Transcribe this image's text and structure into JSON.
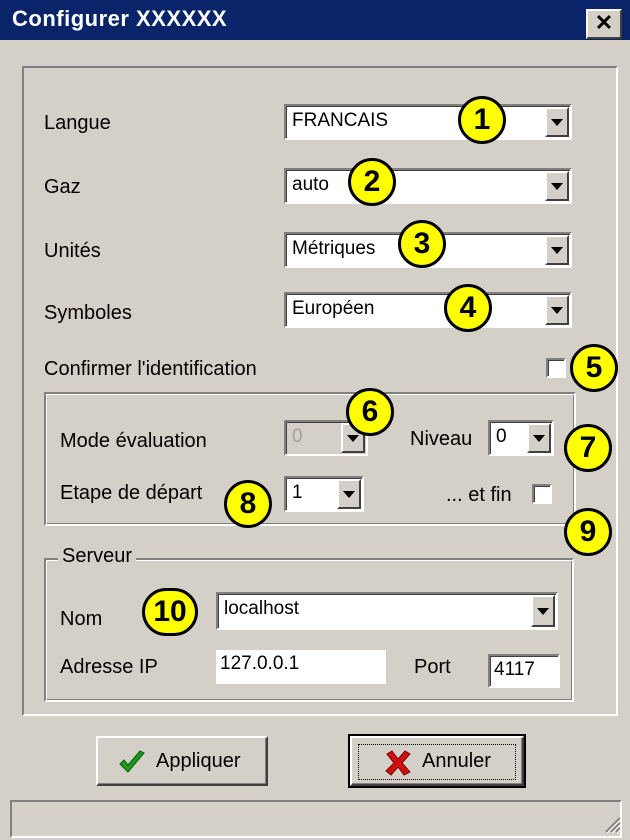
{
  "window": {
    "title": "Configurer  XXXXXX",
    "close_glyph": "✕"
  },
  "fields": {
    "langue": {
      "label": "Langue",
      "value": "FRANCAIS"
    },
    "gaz": {
      "label": "Gaz",
      "value": "auto"
    },
    "unites": {
      "label": "Unités",
      "value": "Métriques"
    },
    "symboles": {
      "label": "Symboles",
      "value": "Européen"
    },
    "confirmer": {
      "label": "Confirmer l'identification",
      "checked": false
    }
  },
  "evaluation": {
    "mode_label": "Mode évaluation",
    "mode_value": "0",
    "niveau_label": "Niveau",
    "niveau_value": "0",
    "etape_label": "Etape de départ",
    "etape_value": "1",
    "fin_label": "... et fin",
    "fin_checked": false
  },
  "serveur": {
    "legend": "Serveur",
    "nom_label": "Nom",
    "nom_value": "localhost",
    "ip_label": "Adresse IP",
    "ip_value": "127.0.0.1",
    "port_label": "Port",
    "port_value": "4117"
  },
  "buttons": {
    "apply_label": "Appliquer",
    "apply_icon": "checkmark-icon",
    "cancel_label": "Annuler",
    "cancel_icon": "red-x-icon"
  },
  "callouts": [
    "1",
    "2",
    "3",
    "4",
    "5",
    "6",
    "7",
    "8",
    "9",
    "10"
  ],
  "colors": {
    "titlebar": "#0a246a",
    "dialog": "#d4d0c8",
    "callout": "#ffff00",
    "apply_check": "#1a9a1a",
    "cancel_x": "#d01010"
  }
}
